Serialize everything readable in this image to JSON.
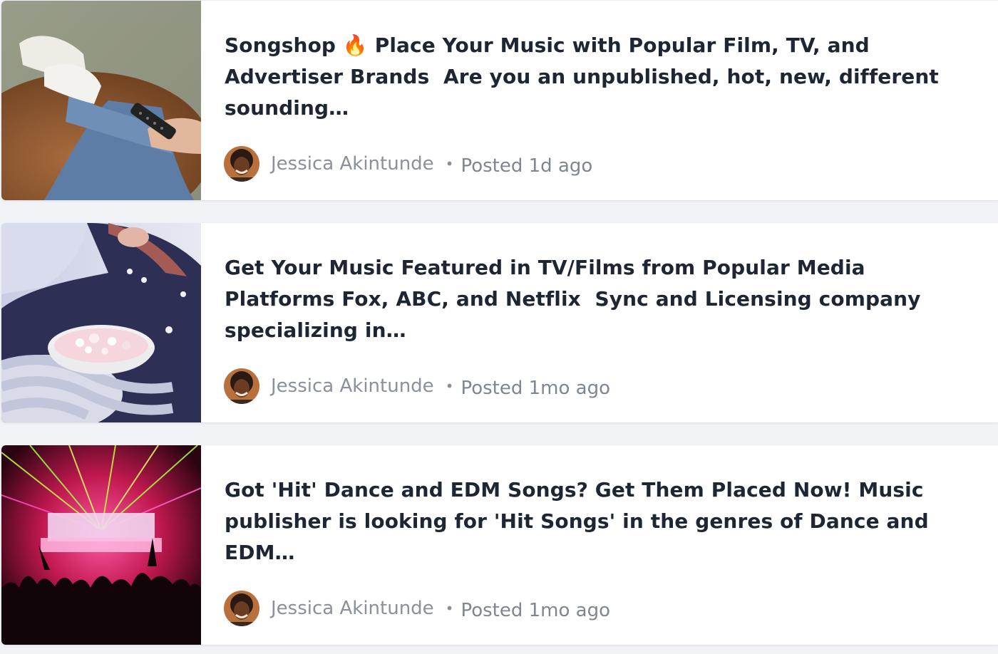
{
  "posts": [
    {
      "title": "Songshop 🔥 Place Your Music with Popular Film, TV, and Advertiser Brands  Are you an unpublished, hot, new, different sounding…",
      "author": "Jessica Akintunde",
      "separator": "•",
      "posted": "Posted 1d ago",
      "thumbnail_icon": "feet-on-table-remote-photo"
    },
    {
      "title": "Get Your Music Featured in TV/Films from Popular Media Platforms Fox, ABC, and Netflix  Sync and Licensing company specializing in…",
      "author": "Jessica Akintunde",
      "separator": "•",
      "posted": "Posted 1mo ago",
      "thumbnail_icon": "popcorn-bowl-photo"
    },
    {
      "title": "Got 'Hit' Dance and EDM Songs? Get Them Placed Now! Music publisher is looking for 'Hit Songs' in the genres of Dance and EDM…",
      "author": "Jessica Akintunde",
      "separator": "•",
      "posted": "Posted 1mo ago",
      "thumbnail_icon": "concert-lasers-photo"
    }
  ],
  "colors": {
    "page_background": "#f2f3f7",
    "card_background": "#ffffff",
    "title_text": "#1f2633",
    "meta_text": "#7e8593"
  }
}
